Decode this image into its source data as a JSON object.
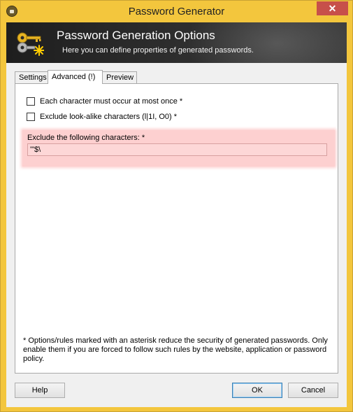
{
  "window": {
    "title": "Password Generator",
    "close_glyph": "✕"
  },
  "banner": {
    "title": "Password Generation Options",
    "subtitle": "Here you can define properties of generated passwords.",
    "icon": "keys-icon"
  },
  "tabs": [
    {
      "label": "Settings",
      "active": false
    },
    {
      "label": "Advanced (!)",
      "active": true
    },
    {
      "label": "Preview",
      "active": false
    }
  ],
  "options": {
    "each_char_once": {
      "label": "Each character must occur at most once *",
      "checked": false
    },
    "exclude_lookalike": {
      "label": "Exclude look-alike characters (l|1I, O0) *",
      "checked": false
    }
  },
  "exclude": {
    "label": "Exclude the following characters: *",
    "value": "'\"$\\"
  },
  "note": "* Options/rules marked with an asterisk reduce the security of generated passwords. Only enable them if you are forced to follow such rules by the website, application or password policy.",
  "buttons": {
    "help": "Help",
    "ok": "OK",
    "cancel": "Cancel"
  }
}
